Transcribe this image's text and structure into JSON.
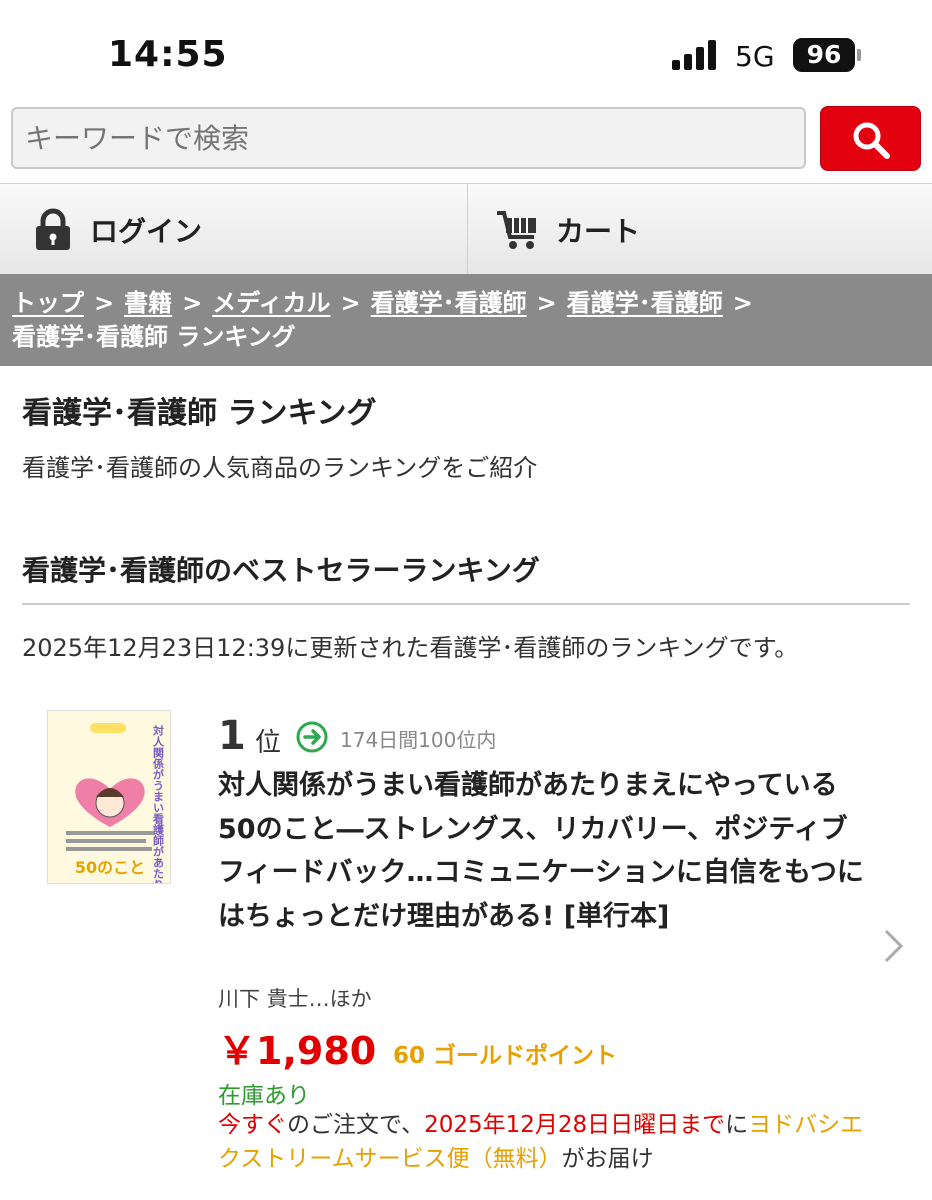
{
  "status_bar": {
    "time": "14:55",
    "network": "5G",
    "battery": "96"
  },
  "search": {
    "placeholder": "キーワードで検索"
  },
  "nav": {
    "login_label": "ログイン",
    "cart_label": "カート"
  },
  "breadcrumb": {
    "items": [
      "トップ",
      "書籍",
      "メディカル",
      "看護学･看護師",
      "看護学･看護師"
    ],
    "current": "看護学･看護師 ランキング",
    "separator": ">"
  },
  "page": {
    "title": "看護学･看護師 ランキング",
    "description": "看護学･看護師の人気商品のランキングをご紹介",
    "section_title": "看護学･看護師のベストセラーランキング",
    "update_note": "2025年12月23日12:39に更新された看護学･看護師のランキングです。"
  },
  "product": {
    "rank_number": "1",
    "rank_label": "位",
    "rank_stay": "174日間100位内",
    "title": "対人関係がうまい看護師があたりまえにやっている50のこと―ストレングス、リカバリー、ポジティブフィードバック…コミュニケーションに自信をもつにはちょっとだけ理由がある! [単行本]",
    "author": "川下 貴士…ほか",
    "price": "￥1,980",
    "points": "60 ゴールドポイント",
    "stock": "在庫あり",
    "delivery": {
      "now": "今すぐ",
      "text1": "のご注文で、",
      "date": "2025年12月28日日曜日まで",
      "text2": "に",
      "service": "ヨドバシエクストリームサービス便（無料）",
      "text3": "がお届け"
    },
    "cover_texts": {
      "vertical_title": "対人関係がうまい看護師があたりまえにやっている",
      "bottom": "50のこと"
    }
  },
  "colors": {
    "accent_red": "#e3000f",
    "price_red": "#e00000",
    "points_orange": "#e8a000",
    "stock_green": "#2e9b2e",
    "breadcrumb_bg": "#8a8a8a"
  },
  "icons": [
    "signal-icon",
    "battery-icon",
    "search-icon",
    "lock-icon",
    "cart-icon",
    "rank-arrow-icon",
    "chevron-right-icon"
  ]
}
